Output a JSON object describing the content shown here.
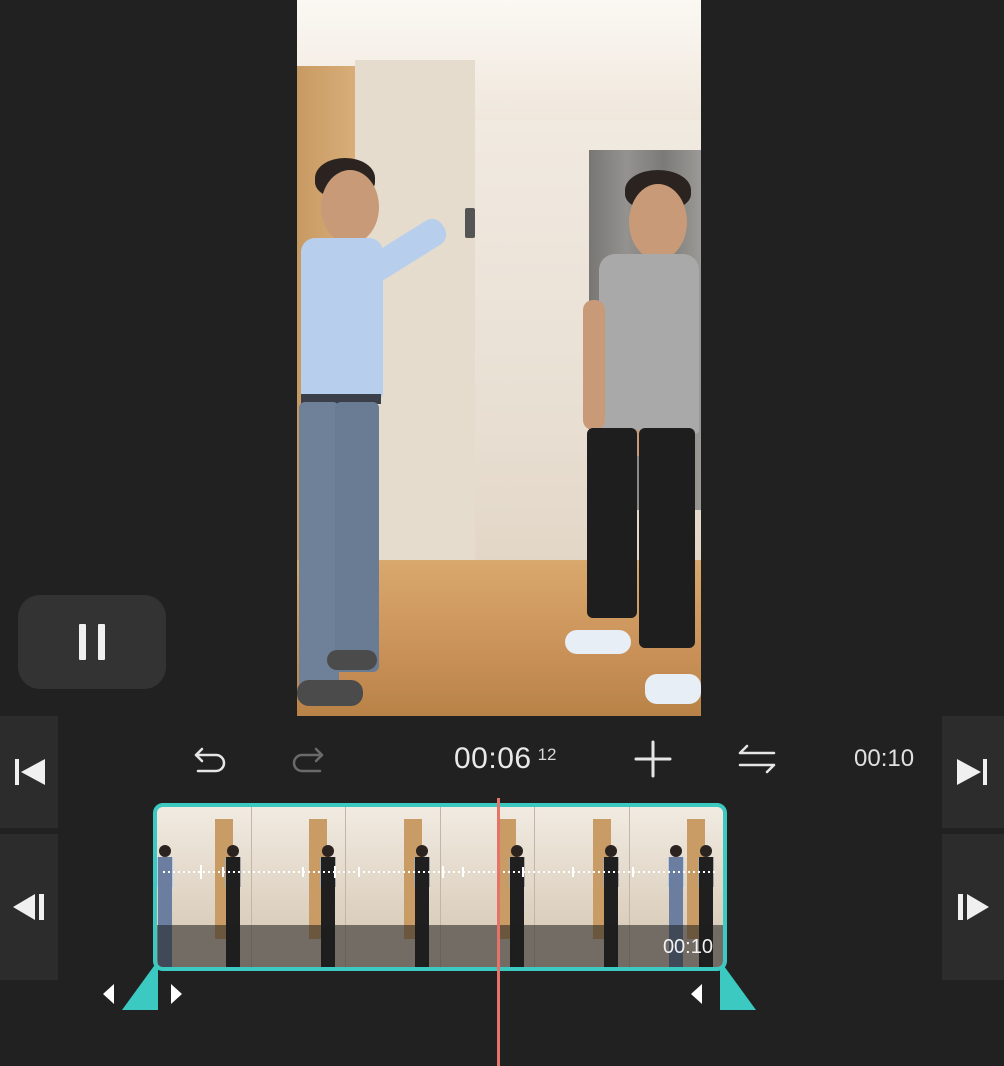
{
  "preview": {
    "state": "playing"
  },
  "toolbar": {
    "current_time": "00:06",
    "current_frame": "12",
    "total_duration": "00:10"
  },
  "timeline": {
    "clip_duration": "00:10",
    "thumbnail_count": 6
  },
  "icons": {
    "pause": "pause-icon",
    "undo": "undo-icon",
    "redo": "redo-icon",
    "add": "plus-icon",
    "swap": "swap-arrows-icon",
    "skip_start": "skip-to-start-icon",
    "skip_end": "skip-to-end-icon",
    "frame_back": "frame-back-icon",
    "frame_forward": "frame-forward-icon"
  },
  "colors": {
    "accent": "#3cc9c1",
    "playhead": "#e4736a",
    "background": "#212121",
    "redo_disabled": "#6a6a6a"
  }
}
